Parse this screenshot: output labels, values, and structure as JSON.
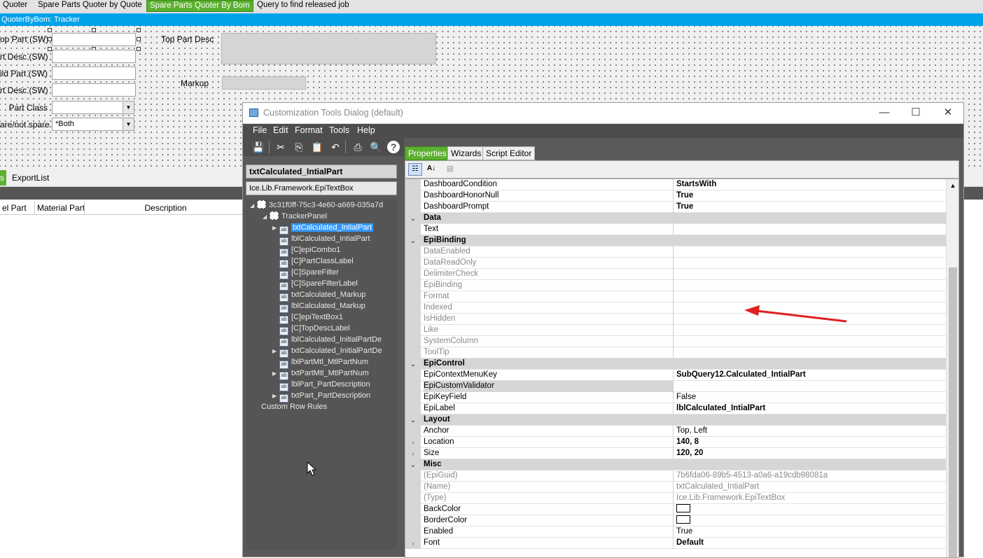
{
  "top_tabs": [
    "Quoter",
    "Spare Parts Quoter by Quote",
    "Spare Parts Quoter By Bom",
    "Query to find released job"
  ],
  "blue_bar": "QuoterByBom: Tracker",
  "form": {
    "top_part_label": "op Part (SW)",
    "part_desc_label": "rt Desc (SW)",
    "child_part_label": "ild Part (SW)",
    "child_desc_label": "rt Desc (SW)",
    "part_class_label": "Part Class",
    "spare_label": "are/not spare",
    "spare_value": "*Both",
    "top_part_desc_label": "Top Part Desc",
    "markup_label": "Markup"
  },
  "lower_tabs": [
    "s",
    "ExportList"
  ],
  "grid_headers": [
    "el Part",
    "Material Part",
    "Description"
  ],
  "dialog": {
    "title": "Customization Tools Dialog (default)",
    "menu": [
      "File",
      "Edit",
      "Format",
      "Tools",
      "Help"
    ],
    "control_name": "txtCalculated_IntialPart",
    "control_type": "Ice.Lib.Framework.EpiTextBox",
    "tree": {
      "root": "3c31f0ff-75c3-4e60-a669-035a7d",
      "panel": "TrackerPanel",
      "items": [
        "txtCalculated_IntialPart",
        "lblCalculated_IntialPart",
        "[C]epiCombo1",
        "[C]PartClassLabel",
        "[C]SpareFilter",
        "[C]SpareFilterLabel",
        "txtCalculated_Markup",
        "lblCalculated_Markup",
        "[C]epiTextBox1",
        "[C]TopDescLabel",
        "lblCalculated_InitialPartDe",
        "txtCalculated_InitialPartDe",
        "lblPartMtl_MtlPartNum",
        "txtPartMtl_MtlPartNum",
        "lblPart_PartDescription",
        "txtPart_PartDescription"
      ],
      "footer": "Custom Row Rules"
    },
    "prop_tabs": [
      "Properties",
      "Wizards",
      "Script Editor"
    ],
    "props": [
      {
        "name": "DashboardCondition",
        "value": "StartsWith"
      },
      {
        "name": "DashboardHonorNull",
        "value": "True"
      },
      {
        "name": "DashboardPrompt",
        "value": "True"
      },
      {
        "name": "Data",
        "value": ""
      },
      {
        "name": "Text",
        "value": ""
      },
      {
        "name": "EpiBinding",
        "value": ""
      },
      {
        "name": "DataEnabled",
        "value": ""
      },
      {
        "name": "DataReadOnly",
        "value": ""
      },
      {
        "name": "DelimiterCheck",
        "value": ""
      },
      {
        "name": "EpiBinding",
        "value": ""
      },
      {
        "name": "Format",
        "value": ""
      },
      {
        "name": "Indexed",
        "value": ""
      },
      {
        "name": "IsHidden",
        "value": ""
      },
      {
        "name": "Like",
        "value": ""
      },
      {
        "name": "SystemColumn",
        "value": ""
      },
      {
        "name": "ToolTip",
        "value": ""
      },
      {
        "name": "EpiControl",
        "value": ""
      },
      {
        "name": "EpiContextMenuKey",
        "value": "SubQuery12.Calculated_IntialPart"
      },
      {
        "name": "EpiCustomValidator",
        "value": ""
      },
      {
        "name": "EpiKeyField",
        "value": "False"
      },
      {
        "name": "EpiLabel",
        "value": "lblCalculated_IntialPart"
      },
      {
        "name": "Layout",
        "value": ""
      },
      {
        "name": "Anchor",
        "value": "Top, Left"
      },
      {
        "name": "Location",
        "value": "140, 8"
      },
      {
        "name": "Size",
        "value": "120, 20"
      },
      {
        "name": "Misc",
        "value": ""
      },
      {
        "name": "(EpiGuid)",
        "value": "7b6fda06-89b5-4513-a0a6-a19cdb98081a"
      },
      {
        "name": "(Name)",
        "value": "txtCalculated_IntialPart"
      },
      {
        "name": "(Type)",
        "value": "Ice.Lib.Framework.EpiTextBox"
      },
      {
        "name": "BackColor",
        "value": ""
      },
      {
        "name": "BorderColor",
        "value": ""
      },
      {
        "name": "Enabled",
        "value": "True"
      },
      {
        "name": "Font",
        "value": "Default"
      }
    ]
  },
  "colors": {
    "accent_green": "#5cb030",
    "title_blue": "#00a2e8",
    "dark_panel": "#555555",
    "arrow_red": "#e02020"
  }
}
